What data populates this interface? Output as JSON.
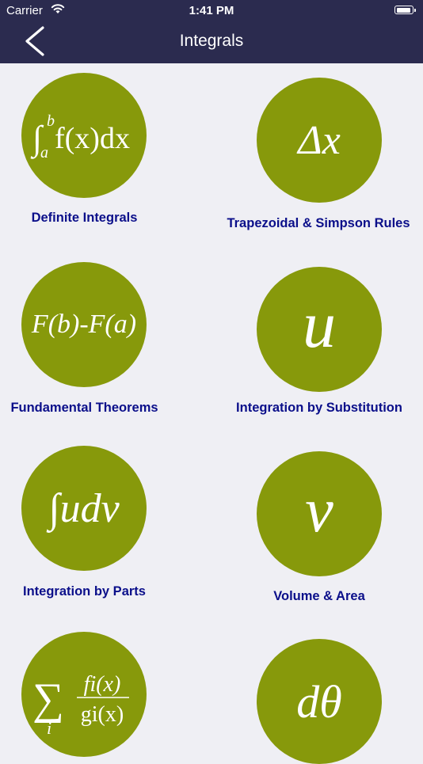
{
  "status_bar": {
    "carrier": "Carrier",
    "time": "1:41 PM",
    "battery_level": 0.95
  },
  "nav": {
    "title": "Integrals"
  },
  "topics": [
    {
      "label": "Definite Integrals",
      "icon": "definite-integral-symbol-icon",
      "symbol": {
        "upper": "b",
        "lower": "a",
        "body": "f(x)dx"
      }
    },
    {
      "label": "Trapezoidal & Simpson Rules",
      "icon": "delta-x-symbol-icon",
      "symbol": "Δx"
    },
    {
      "label": "Fundamental Theorems",
      "icon": "fundamental-theorem-symbol-icon",
      "symbol": "F(b)-F(a)"
    },
    {
      "label": "Integration by Substitution",
      "icon": "u-symbol-icon",
      "symbol": "u"
    },
    {
      "label": "Integration by Parts",
      "icon": "integral-udv-symbol-icon",
      "symbol": "∫udv"
    },
    {
      "label": "Volume & Area",
      "icon": "v-symbol-icon",
      "symbol": "v"
    },
    {
      "label": "",
      "icon": "sum-fraction-symbol-icon",
      "symbol": {
        "sigma": "∑",
        "index": "i",
        "numerator": "fi(x)",
        "denominator": "gi(x)"
      }
    },
    {
      "label": "",
      "icon": "d-theta-symbol-icon",
      "symbol": "dθ"
    }
  ],
  "colors": {
    "header": "#2b2b4f",
    "background": "#efeff4",
    "circle": "#87990b",
    "label": "#0b0f8a"
  }
}
